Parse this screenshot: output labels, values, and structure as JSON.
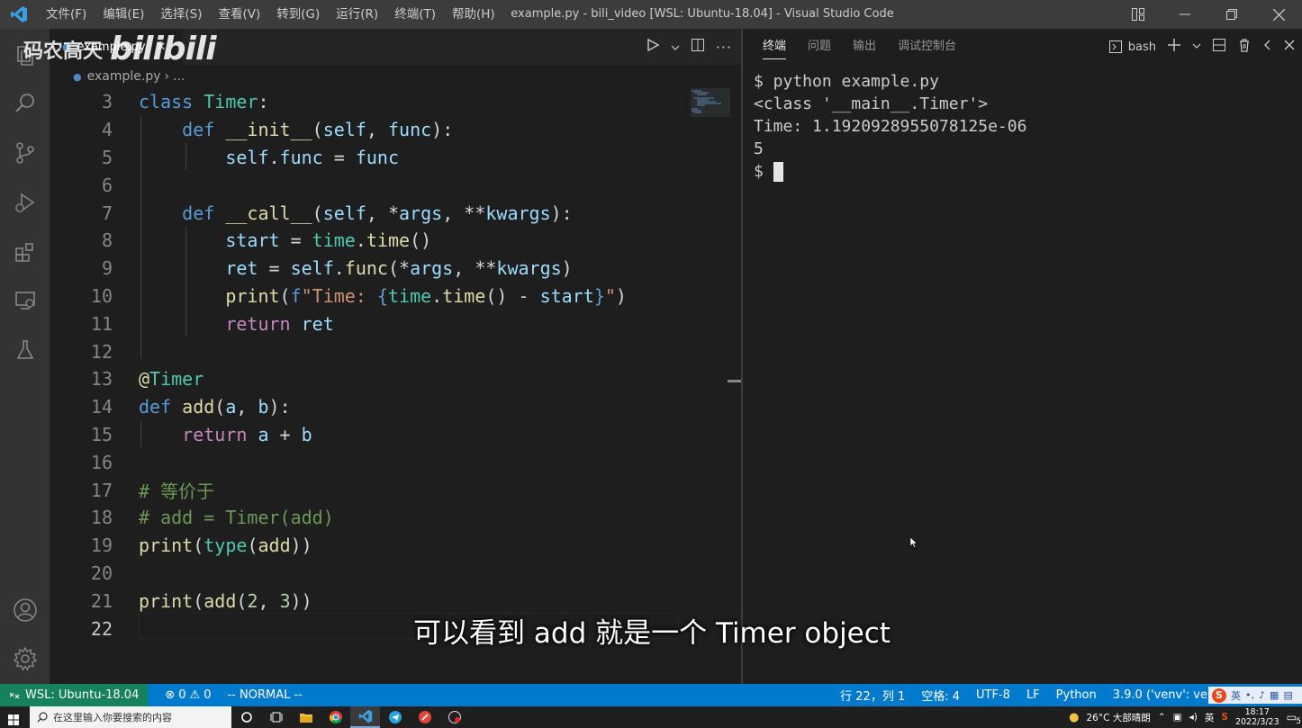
{
  "titlebar": {
    "menu": [
      "文件(F)",
      "编辑(E)",
      "选择(S)",
      "查看(V)",
      "转到(G)",
      "运行(R)",
      "终端(T)",
      "帮助(H)"
    ],
    "title": "example.py - bili_video [WSL: Ubuntu-18.04] - Visual Studio Code"
  },
  "editor": {
    "tab_label": "example.py",
    "breadcrumb_file": "example.py",
    "breadcrumb_rest": "...",
    "line_numbers": [
      "3",
      "4",
      "5",
      "6",
      "7",
      "8",
      "9",
      "10",
      "11",
      "12",
      "13",
      "14",
      "15",
      "16",
      "17",
      "18",
      "19",
      "20",
      "21",
      "22"
    ],
    "active_line": "22"
  },
  "panel": {
    "tabs": [
      "终端",
      "问题",
      "输出",
      "调试控制台"
    ],
    "active_tab": "终端",
    "shell": "bash",
    "terminal_lines": [
      "$ python example.py",
      "<class '__main__.Timer'>",
      "Time: 1.1920928955078125e-06",
      "5",
      "$ "
    ]
  },
  "statusbar": {
    "remote": "WSL: Ubuntu-18.04",
    "errors": "0",
    "warnings": "0",
    "mode": "-- NORMAL --",
    "position": "行 22，列 1",
    "spaces": "空格: 4",
    "encoding": "UTF-8",
    "eol": "LF",
    "language": "Python",
    "interpreter": "3.9.0 ('venv': ve"
  },
  "taskbar": {
    "search_placeholder": "在这里输入你要搜索的内容",
    "weather": "26°C 大部晴朗",
    "ime": "英",
    "time": "18:17",
    "date": "2022/3/23",
    "notification_count": "5"
  },
  "overlay": {
    "watermark_text": "码农高天",
    "watermark_logo": "bilibili",
    "subtitle": "可以看到 add 就是一个 Timer object"
  },
  "colors": {
    "statusbar": "#007acc",
    "remote": "#16825d",
    "editor_bg": "#1e1e1e",
    "activitybar": "#333333"
  }
}
